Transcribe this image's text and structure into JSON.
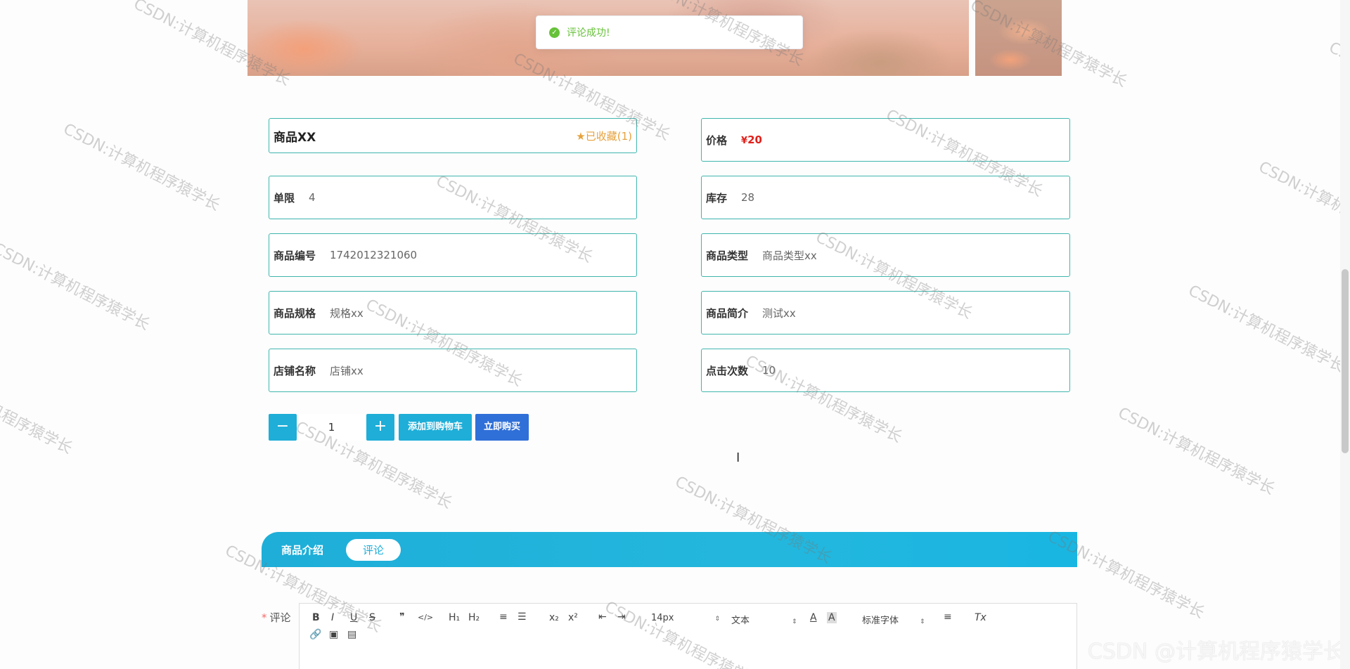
{
  "toast": {
    "message": "评论成功!"
  },
  "product": {
    "name": "商品XX",
    "favorite": "已收藏(1)",
    "price_label": "价格",
    "price_symbol": "¥",
    "price_value": "20",
    "fields": [
      {
        "label": "单限",
        "value": "4"
      },
      {
        "label": "库存",
        "value": "28"
      },
      {
        "label": "商品编号",
        "value": "1742012321060"
      },
      {
        "label": "商品类型",
        "value": "商品类型xx"
      },
      {
        "label": "商品规格",
        "value": "规格xx"
      },
      {
        "label": "商品简介",
        "value": "测试xx"
      },
      {
        "label": "店铺名称",
        "value": "店铺xx"
      },
      {
        "label": "点击次数",
        "value": "10"
      }
    ]
  },
  "purchase": {
    "minus": "−",
    "plus": "+",
    "quantity": "1",
    "add_to_cart": "添加到购物车",
    "buy_now": "立即购买"
  },
  "tabs": [
    {
      "label": "商品介绍",
      "active": false
    },
    {
      "label": "评论",
      "active": true
    }
  ],
  "comment": {
    "required_mark": "*",
    "label": "评论",
    "toolbar": {
      "bold": "B",
      "italic": "I",
      "underline": "U",
      "strike": "S",
      "quote": "❞",
      "code": "</>",
      "h1": "H₁",
      "h2": "H₂",
      "ordered": "≡",
      "bullet": "☰",
      "sub": "x₂",
      "sup": "x²",
      "outdent": "⇤",
      "indent": "⇥",
      "size": "14px",
      "header": "文本",
      "color": "A",
      "background": "A",
      "font": "标准字体",
      "align": "≡",
      "clean": "Tx",
      "link": "🔗",
      "image": "▣",
      "video": "▤"
    }
  },
  "watermark": "CSDN:计算机程序猿学长",
  "corner_watermark": "CSDN @计算机程序猿学长"
}
